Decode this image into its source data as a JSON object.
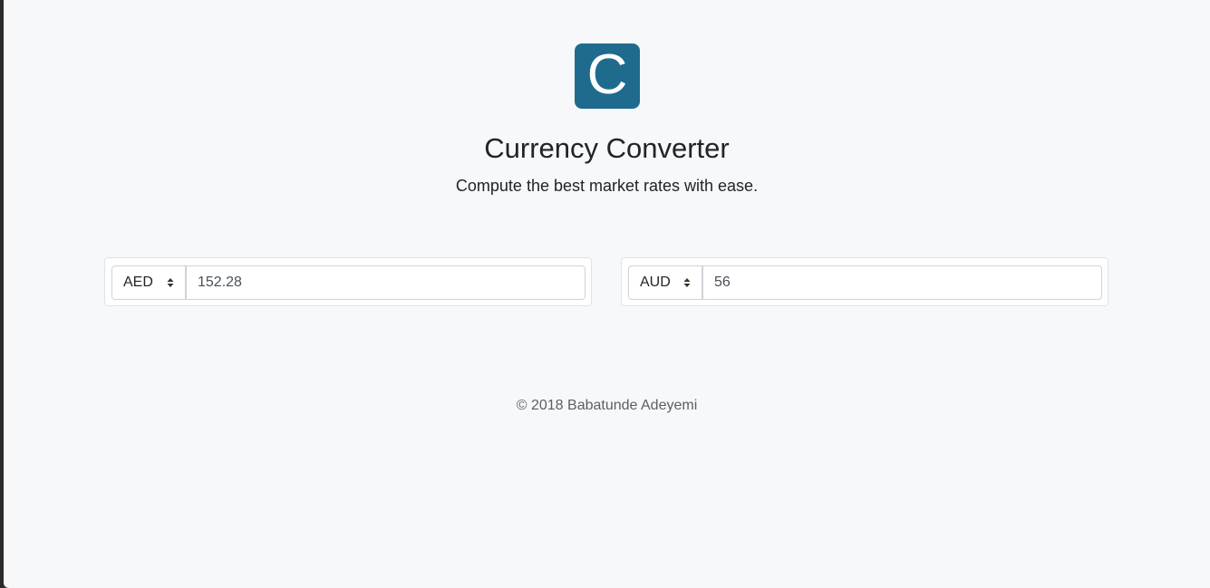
{
  "app": {
    "logo_letter": "C",
    "title": "Currency Converter",
    "subtitle": "Compute the best market rates with ease."
  },
  "converter": {
    "from": {
      "currency": "AED",
      "amount": "152.28"
    },
    "to": {
      "currency": "AUD",
      "amount": "56"
    }
  },
  "footer": {
    "text": "© 2018 Babatunde Adeyemi"
  },
  "icons": {
    "logo": "currency-converter-logo",
    "select_arrows": "sort-arrows-icon"
  },
  "colors": {
    "brand": "#1f6b8e",
    "background": "#f7f8fa",
    "text": "#222326"
  }
}
